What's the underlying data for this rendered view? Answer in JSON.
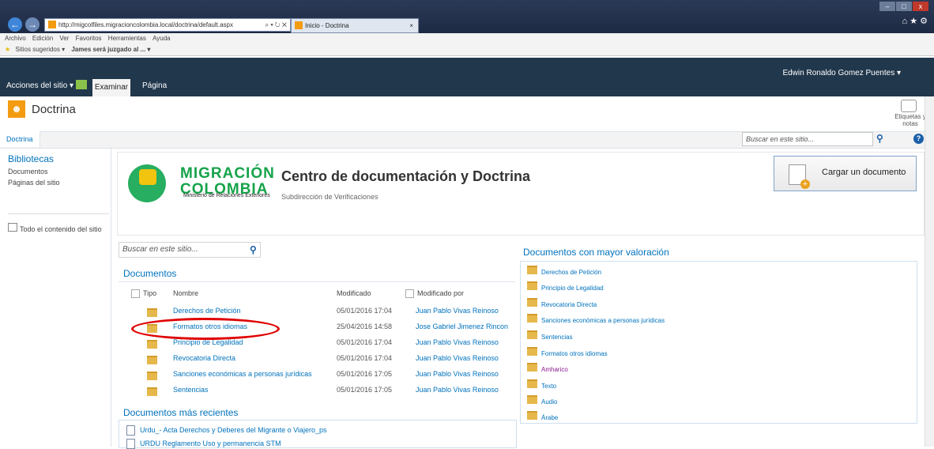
{
  "browser": {
    "address_url": "http://migcolfiles.migracioncolombia.local/doctrina/default.aspx",
    "address_controls": "⌕ ▾ ↻ ✕",
    "tab_title": "Inicio - Doctrina",
    "tab_close": "×",
    "menu": [
      "Archivo",
      "Edición",
      "Ver",
      "Favoritos",
      "Herramientas",
      "Ayuda"
    ],
    "favorites": [
      "Sitios sugeridos ▾",
      "James será juzgado al ... ▾"
    ],
    "window_controls": [
      "–",
      "□",
      "x"
    ]
  },
  "ribbon": {
    "acciones": "Acciones del sitio ▾",
    "examinar": "Examinar",
    "pagina": "Página",
    "user": "Edwin Ronaldo Gomez Puentes ▾"
  },
  "site": {
    "title": "Doctrina",
    "tags_notes": "Etiquetas y notas",
    "breadcrumb": "Doctrina",
    "search_placeholder": "Buscar en este sitio...",
    "help": "?"
  },
  "leftnav": {
    "heading": "Bibliotecas",
    "items": [
      "Documentos",
      "Páginas del sitio"
    ],
    "all_content": "Todo el contenido del sitio"
  },
  "main": {
    "logo_line1": "MIGRACIÓN",
    "logo_line2": "COLOMBIA",
    "logo_tagline": "Ministerio de Relaciones Exteriores",
    "title": "Centro de documentación y Doctrina",
    "subtitle": "Subdirección de Verificaciones",
    "upload_label": "Cargar un documento",
    "search_placeholder": "Buscar en este sitio...",
    "documents_heading": "Documentos",
    "columns": {
      "tipo": "Tipo",
      "nombre": "Nombre",
      "modificado": "Modificado",
      "modificado_por": "Modificado por"
    },
    "documents": [
      {
        "name": "Derechos de Petición",
        "modified": "05/01/2016 17:04",
        "by": "Juan Pablo Vivas Reinoso"
      },
      {
        "name": "Formatos otros idiomas",
        "modified": "25/04/2016 14:58",
        "by": "Jose Gabriel Jimenez Rincon"
      },
      {
        "name": "Principio de Legalidad",
        "modified": "05/01/2016 17:04",
        "by": "Juan Pablo Vivas Reinoso"
      },
      {
        "name": "Revocatoria Directa",
        "modified": "05/01/2016 17:04",
        "by": "Juan Pablo Vivas Reinoso"
      },
      {
        "name": "Sanciones económicas a personas jurídicas",
        "modified": "05/01/2016 17:05",
        "by": "Juan Pablo Vivas Reinoso"
      },
      {
        "name": "Sentencias",
        "modified": "05/01/2016 17:05",
        "by": "Juan Pablo Vivas Reinoso"
      }
    ],
    "recent_heading": "Documentos más recientes",
    "recent": [
      "Urdu_- Acta Derechos y Deberes del Migrante o Viajero_ps",
      "URDU Reglamento Uso y permanencia STM"
    ],
    "rated_heading": "Documentos con mayor valoración",
    "rated": [
      "Derechos de Petición",
      "Principio de Legalidad",
      "Revocatoria Directa",
      "Sanciones económicas a personas jurídicas",
      "Sentencias",
      "Formatos otros idiomas",
      "Amharico",
      "Texto",
      "Audio",
      "Árabe"
    ]
  }
}
